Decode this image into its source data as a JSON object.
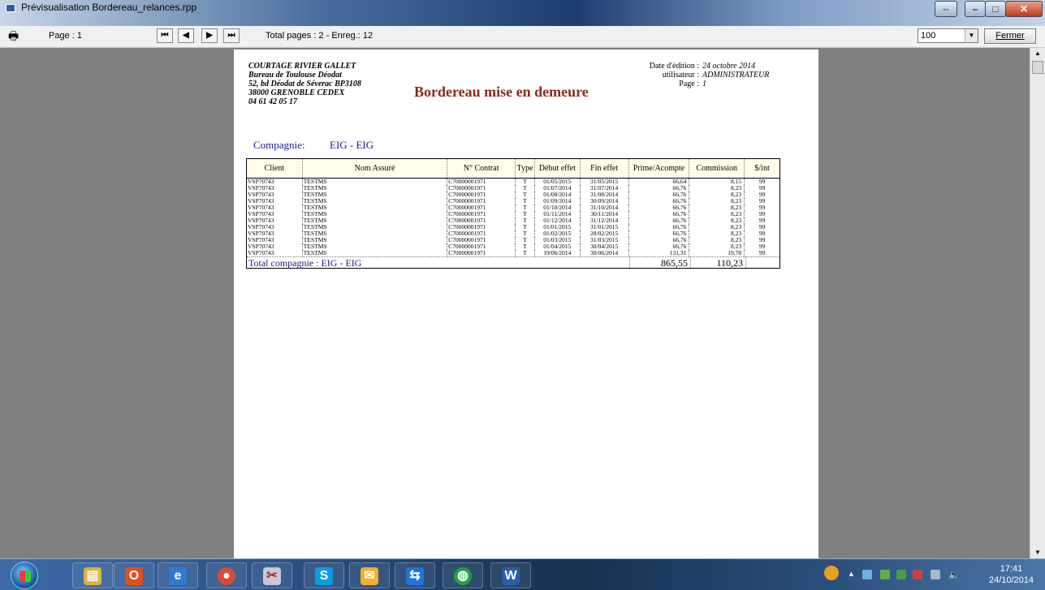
{
  "window": {
    "title": "Prévisualisation Bordereau_relances.rpp"
  },
  "toolbar": {
    "page_label": "Page : 1",
    "total_label": "Total pages : 2 - Enreg.: 12",
    "zoom_value": "100",
    "close_label": "Fermer",
    "nav_first": "⏮",
    "nav_prev": "◀",
    "nav_next": "▶",
    "nav_last": "⏭"
  },
  "report": {
    "company_lines": [
      "COURTAGE RIVIER GALLET",
      "Bureau de Toulouse Déodat",
      "52, bd Déodat de Séverac BP3108",
      "38000 GRENOBLE CEDEX",
      "04 61 42 05 17"
    ],
    "title": "Bordereau mise en demeure",
    "edition_label": "Date d'édition :",
    "edition_value": "24 octobre 2014",
    "user_label": "utilisateur :",
    "user_value": "ADMINISTRATEUR",
    "page_label": "Page :",
    "page_value": "1",
    "compagnie_label": "Compagnie:",
    "compagnie_value": "EIG - EIG",
    "columns": [
      "Client",
      "Nom Assuré",
      "N° Contrat",
      "Type",
      "Début effet",
      "Fin effet",
      "Prime/Acompte",
      "Commission",
      "$/int"
    ],
    "rows": [
      [
        "VSP70743",
        "TESTMS",
        "C70000001971",
        "T",
        "01/05/2015",
        "31/05/2015",
        "66,64",
        "8,15",
        "99"
      ],
      [
        "VSP70743",
        "TESTMS",
        "C70000001971",
        "T",
        "01/07/2014",
        "31/07/2014",
        "66,76",
        "8,23",
        "99"
      ],
      [
        "VSP70743",
        "TESTMS",
        "C70000001971",
        "T",
        "01/08/2014",
        "31/08/2014",
        "66,76",
        "8,23",
        "99"
      ],
      [
        "VSP70743",
        "TESTMS",
        "C70000001971",
        "T",
        "01/09/2014",
        "30/09/2014",
        "66,76",
        "8,23",
        "99"
      ],
      [
        "VSP70743",
        "TESTMS",
        "C70000001971",
        "T",
        "01/10/2014",
        "31/10/2014",
        "66,76",
        "8,23",
        "99"
      ],
      [
        "VSP70743",
        "TESTMS",
        "C70000001971",
        "T",
        "01/11/2014",
        "30/11/2014",
        "66,76",
        "8,23",
        "99"
      ],
      [
        "VSP70743",
        "TESTMS",
        "C70000001971",
        "T",
        "01/12/2014",
        "31/12/2014",
        "66,76",
        "8,23",
        "99"
      ],
      [
        "VSP70743",
        "TESTMS",
        "C70000001971",
        "T",
        "01/01/2015",
        "31/01/2015",
        "66,76",
        "8,23",
        "99"
      ],
      [
        "VSP70743",
        "TESTMS",
        "C70000001971",
        "T",
        "01/02/2015",
        "28/02/2015",
        "66,76",
        "8,23",
        "99"
      ],
      [
        "VSP70743",
        "TESTMS",
        "C70000001971",
        "T",
        "01/03/2015",
        "31/03/2015",
        "66,76",
        "8,23",
        "99"
      ],
      [
        "VSP70743",
        "TESTMS",
        "C70000001971",
        "T",
        "01/04/2015",
        "30/04/2015",
        "66,76",
        "8,23",
        "99"
      ],
      [
        "VSP70743",
        "TESTMS",
        "C70000001971",
        "T",
        "19/06/2014",
        "30/06/2014",
        "131,31",
        "19,78",
        "99"
      ]
    ],
    "total_label": "Total compagnie : EIG - EIG",
    "total_prime": "865,55",
    "total_commission": "110,23"
  },
  "taskbar": {
    "clock_time": "17:41",
    "clock_date": "24/10/2014"
  }
}
